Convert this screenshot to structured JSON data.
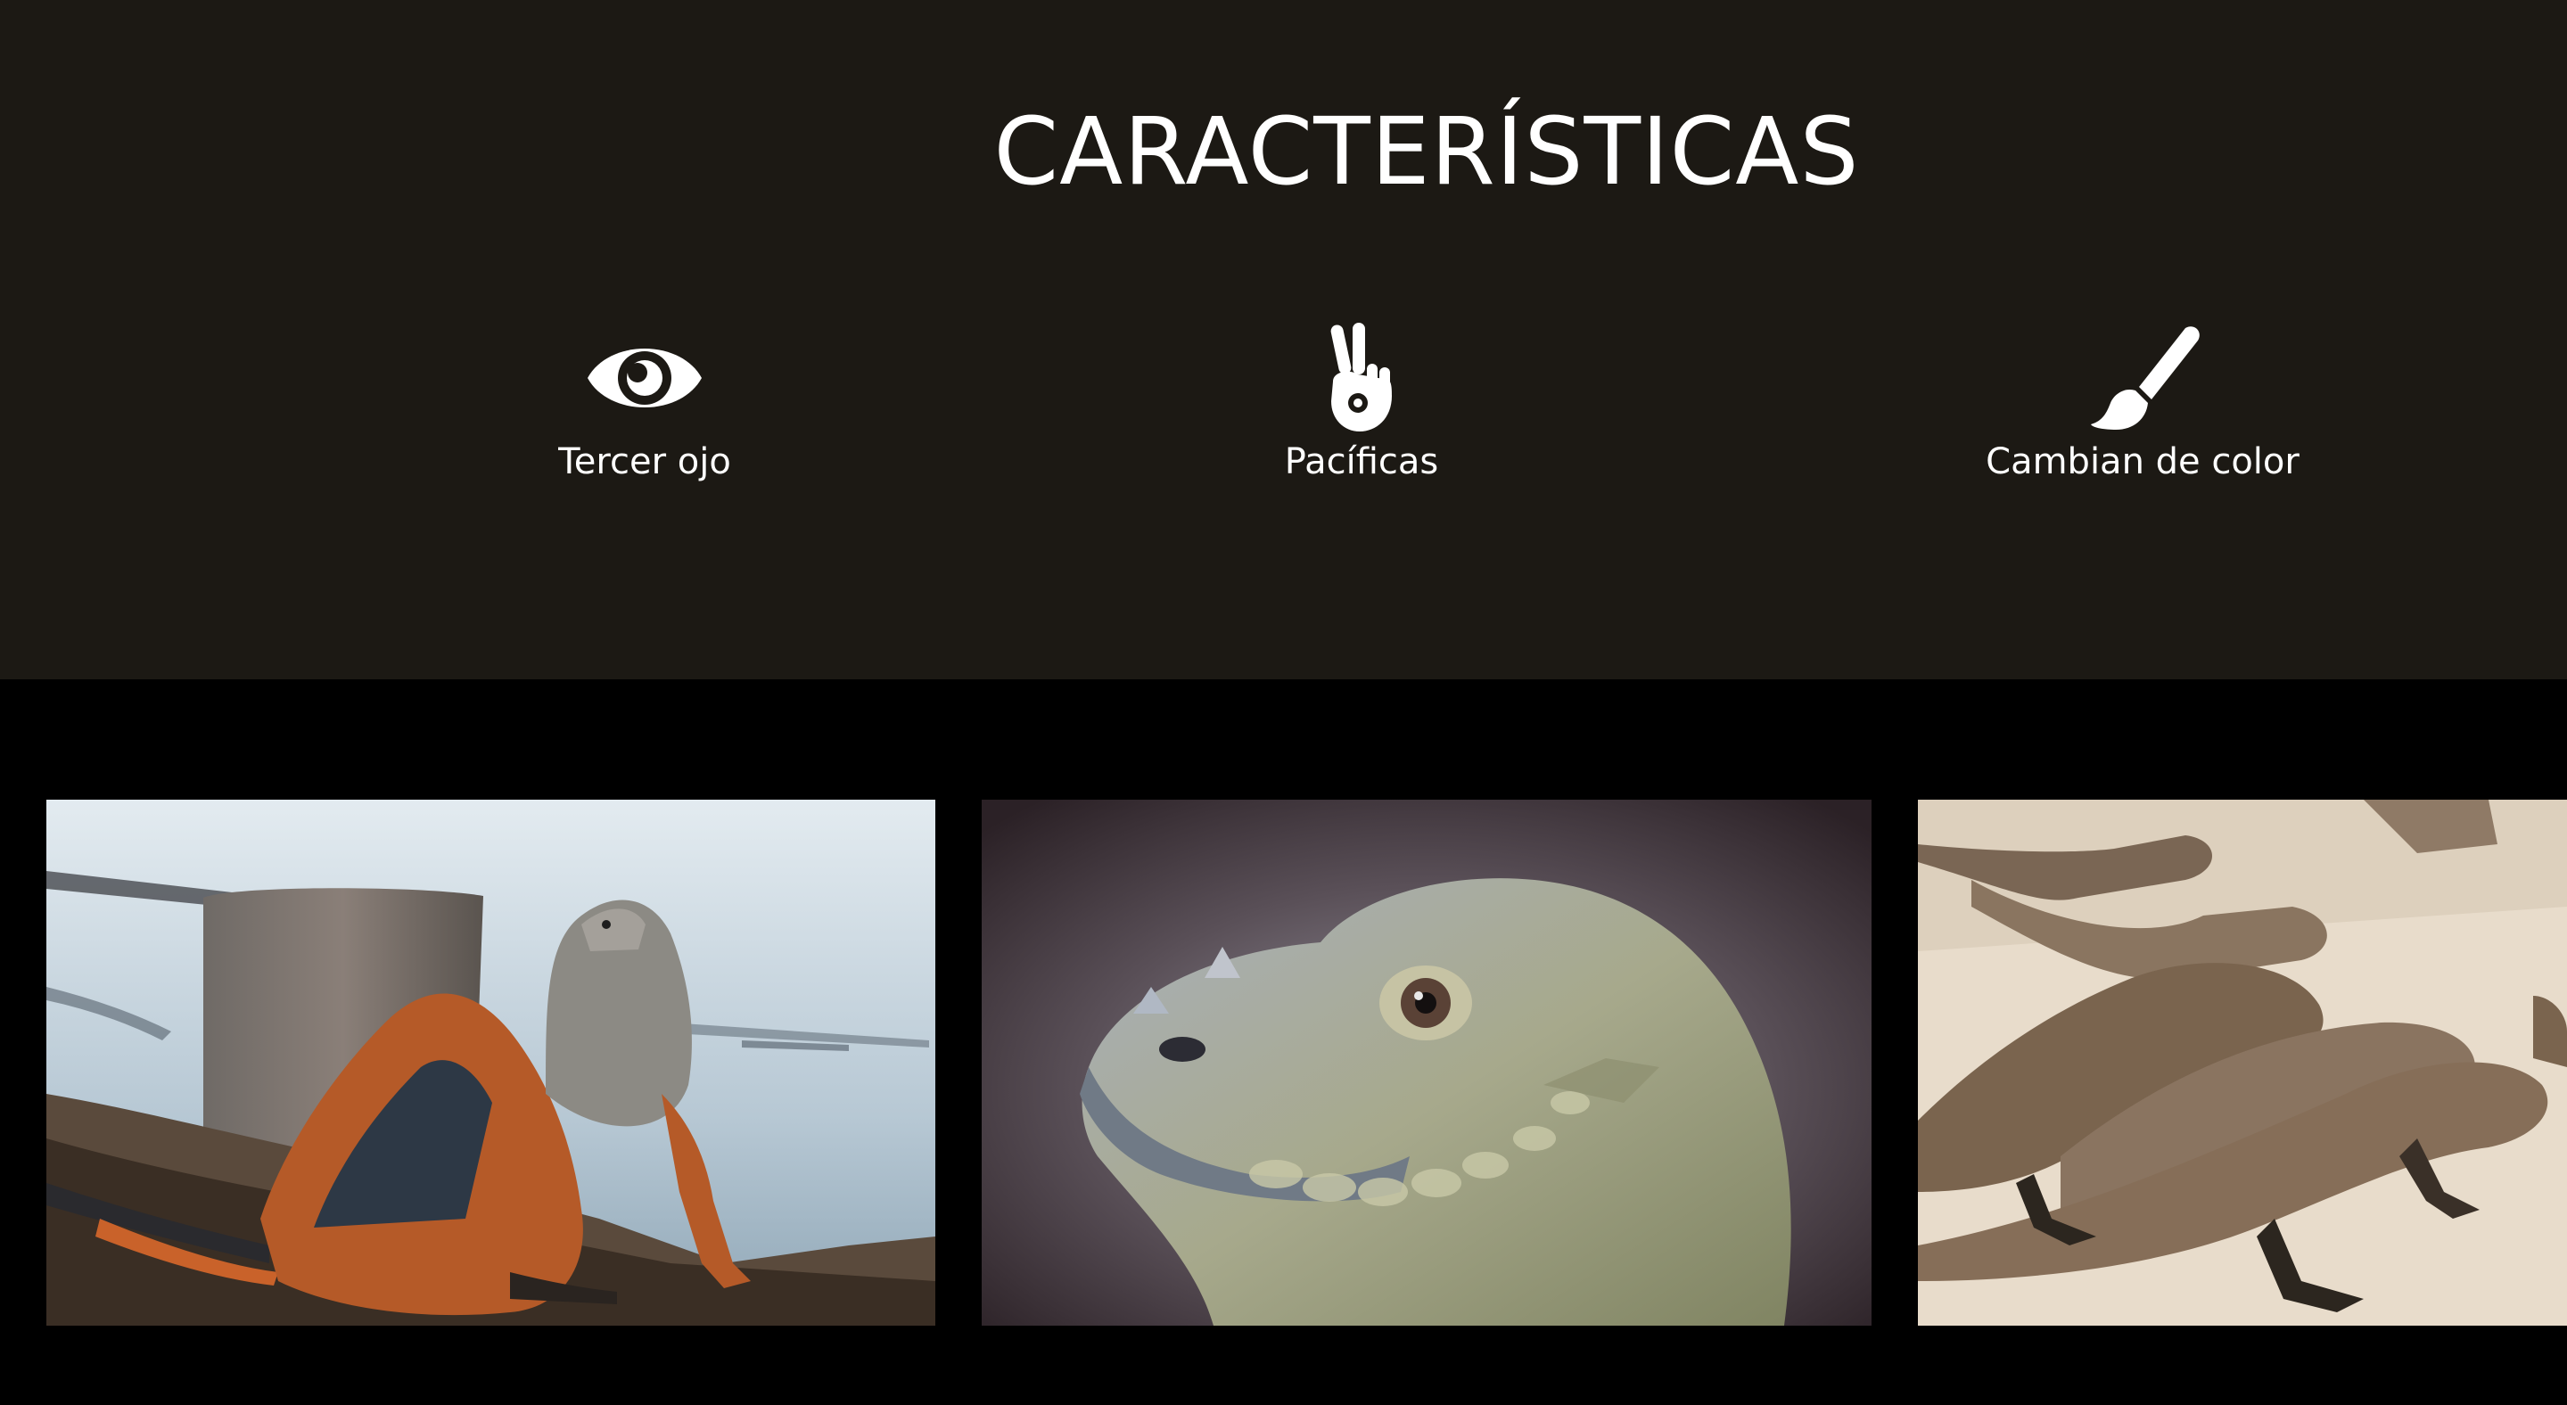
{
  "features": {
    "title": "CARACTERÍSTICAS",
    "items": [
      {
        "icon": "eye-icon",
        "label": "Tercer ojo"
      },
      {
        "icon": "peace-hand-icon",
        "label": "Pacíficas"
      },
      {
        "icon": "paintbrush-icon",
        "label": "Cambian de color"
      }
    ]
  },
  "gallery": {
    "images": [
      {
        "subject": "iguana-on-rocky-shore"
      },
      {
        "subject": "iguana-head-closeup"
      },
      {
        "subject": "iguanas-on-sand"
      }
    ]
  },
  "colors": {
    "features_background": "#1c1914",
    "gallery_background": "#000000",
    "text": "#ffffff"
  }
}
